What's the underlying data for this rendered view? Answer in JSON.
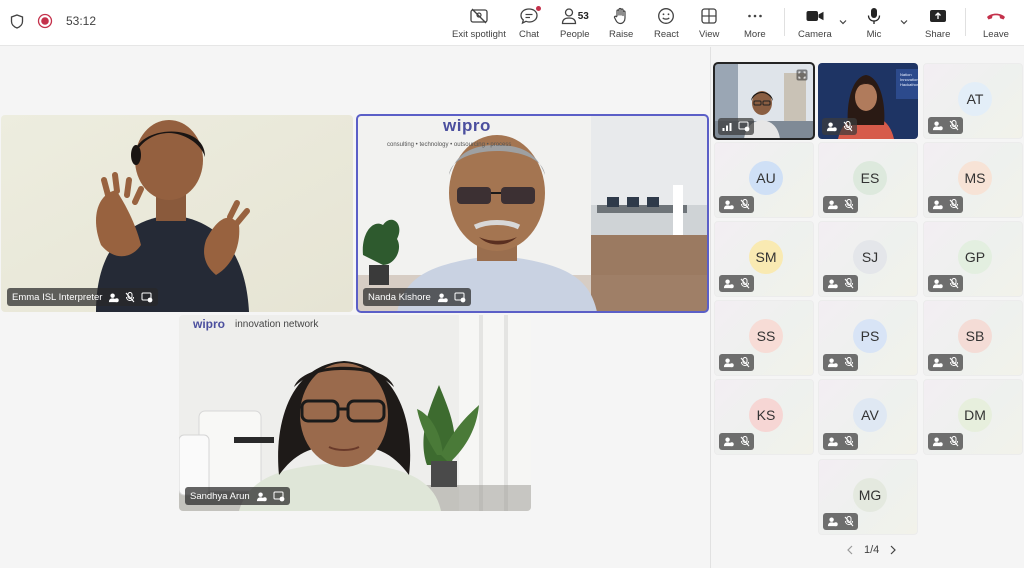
{
  "header": {
    "timer": "53:12",
    "buttons": {
      "exit_spotlight": "Exit spotlight",
      "chat": "Chat",
      "people": "People",
      "people_count": "53",
      "raise": "Raise",
      "react": "React",
      "view": "View",
      "more": "More",
      "camera": "Camera",
      "mic": "Mic",
      "share": "Share",
      "leave": "Leave"
    }
  },
  "stage": {
    "tiles": [
      {
        "name": "Emma ISL Interpreter"
      },
      {
        "name": "Nanda Kishore"
      },
      {
        "name": "Sandhya Arun"
      }
    ],
    "logo_top": "wipro",
    "logo_tagline": "consulting • technology • outsourcing • process",
    "logo_bottom": "wipro",
    "logo_bottom_sub": "innovation network",
    "poster_text": "Nation Innovation Hackathon"
  },
  "rail": {
    "participants": [
      {
        "initials": "AT",
        "color": "#e3eef8"
      },
      {
        "initials": "AU",
        "color": "#cfe0f6"
      },
      {
        "initials": "ES",
        "color": "#dde9dd"
      },
      {
        "initials": "MS",
        "color": "#f7e3d6"
      },
      {
        "initials": "SM",
        "color": "#f9eab2"
      },
      {
        "initials": "SJ",
        "color": "#e4e6ea"
      },
      {
        "initials": "GP",
        "color": "#e3efe0"
      },
      {
        "initials": "SS",
        "color": "#f7dcd6"
      },
      {
        "initials": "PS",
        "color": "#d8e4f6"
      },
      {
        "initials": "SB",
        "color": "#f4dcd6"
      },
      {
        "initials": "KS",
        "color": "#f6d6d4"
      },
      {
        "initials": "AV",
        "color": "#dfe8f3"
      },
      {
        "initials": "DM",
        "color": "#e7efdd"
      },
      {
        "initials": "MG",
        "color": "#e4e9df"
      }
    ],
    "page": "1/4"
  },
  "colors": {
    "accent": "#5b5fc7",
    "leave": "#c4314b",
    "record": "#c4314b"
  }
}
